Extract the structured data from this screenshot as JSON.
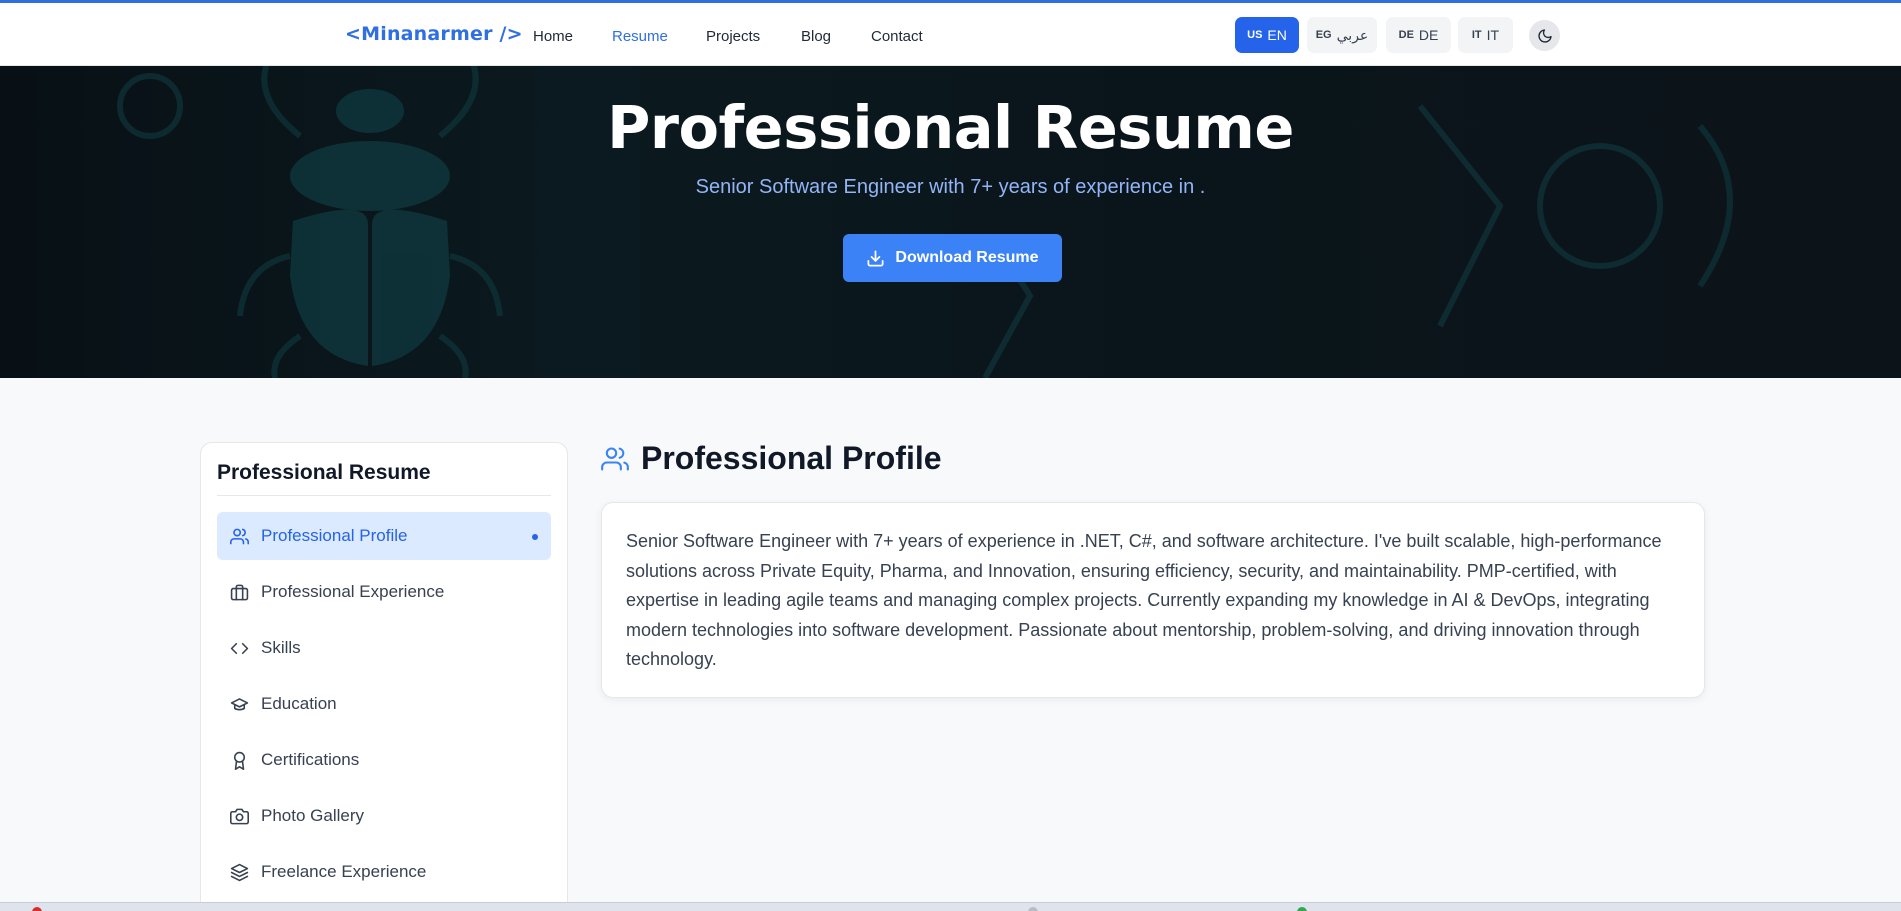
{
  "nav": {
    "brand": "<Minanarmer />",
    "links": [
      "Home",
      "Resume",
      "Projects",
      "Blog",
      "Contact"
    ],
    "active_link": "Resume",
    "languages": [
      {
        "flag": "US",
        "label": "EN"
      },
      {
        "flag": "EG",
        "label": "عربي"
      },
      {
        "flag": "DE",
        "label": "DE"
      },
      {
        "flag": "IT",
        "label": "IT"
      }
    ],
    "active_language": "EN",
    "theme_toggle_icon": "moon-icon"
  },
  "hero": {
    "title": "Professional Resume",
    "subtitle": "Senior Software Engineer with 7+ years of experience in .",
    "download_label": "Download Resume"
  },
  "sidebar": {
    "title": "Professional Resume",
    "items": [
      {
        "label": "Professional Profile",
        "icon": "users-icon"
      },
      {
        "label": "Professional Experience",
        "icon": "briefcase-icon"
      },
      {
        "label": "Skills",
        "icon": "code-icon"
      },
      {
        "label": "Education",
        "icon": "graduation-cap-icon"
      },
      {
        "label": "Certifications",
        "icon": "award-icon"
      },
      {
        "label": "Photo Gallery",
        "icon": "camera-icon"
      },
      {
        "label": "Freelance Experience",
        "icon": "layers-icon"
      }
    ],
    "active_item": "Professional Profile"
  },
  "main": {
    "section_title": "Professional Profile",
    "section_icon": "users-icon",
    "profile_text": "Senior Software Engineer with 7+ years of experience in .NET, C#, and software architecture. I've built scalable, high-performance solutions across Private Equity, Pharma, and Innovation, ensuring efficiency, security, and maintainability. PMP-certified, with expertise in leading agile teams and managing complex projects. Currently expanding my knowledge in AI & DevOps, integrating modern technologies into software development. Passionate about mentorship, problem-solving, and driving innovation through technology."
  },
  "colors": {
    "accent": "#2f6fe0",
    "button_blue": "#3b82f6",
    "hero_bg": "#0a151b"
  }
}
